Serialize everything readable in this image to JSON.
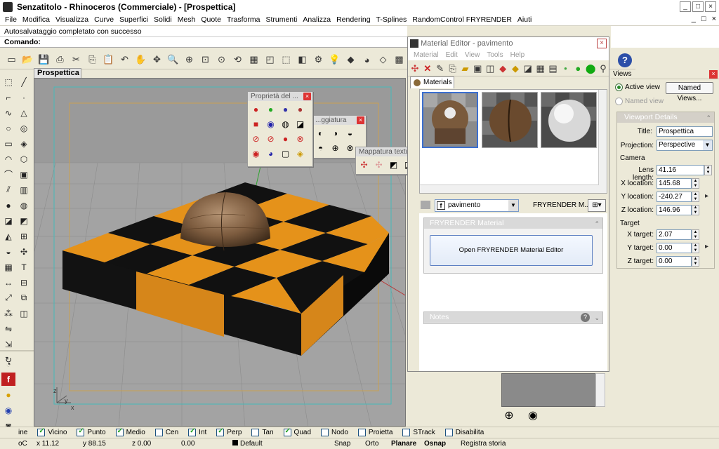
{
  "window": {
    "title": "Senzatitolo - Rhinoceros (Commerciale) - [Prospettica]",
    "min": "_",
    "max": "□",
    "close": "×"
  },
  "menu": [
    "File",
    "Modifica",
    "Visualizza",
    "Curve",
    "Superfici",
    "Solidi",
    "Mesh",
    "Quote",
    "Trasforma",
    "Strumenti",
    "Analizza",
    "Rendering",
    "T-Splines",
    "RandomControl FRYRENDER",
    "Aiuti"
  ],
  "mdi_controls": [
    "_",
    "□",
    "×"
  ],
  "command": {
    "history": "Autosalvataggio completato con successo",
    "prompt": "Comando:"
  },
  "viewport": {
    "tab": "Prospettica",
    "axis_x": "x",
    "axis_y": "y",
    "axis_z": "z"
  },
  "float_windows": {
    "proprieta": "Proprietà del ...",
    "ombreggiatura": "...ggiatura",
    "mappatura": "Mappatura texture",
    "close": "×"
  },
  "material_editor": {
    "title": "Material Editor - pavimento",
    "close": "×",
    "menu": [
      "Material",
      "Edit",
      "View",
      "Tools",
      "Help"
    ],
    "tab": "Materials",
    "selected_material": "pavimento",
    "material_glyph": "f",
    "renderer": "FRYRENDER M...",
    "panel_title": "FRYRENDER Material",
    "open_button": "Open FRYRENDER Material Editor",
    "notes_title": "Notes",
    "help_glyph": "?",
    "collapse_glyph": "⌃",
    "expand_glyph": "⌄"
  },
  "views_panel": {
    "title": "Views",
    "close": "×",
    "active_view": "Active view",
    "named_view": "Named view",
    "named_views_button": "Named Views...",
    "details_title": "Viewport Details",
    "collapse_glyph": "⌃",
    "title_label": "Title:",
    "title_value": "Prospettica",
    "projection_label": "Projection:",
    "projection_value": "Perspective",
    "camera_label": "Camera",
    "lens_label": "Lens length:",
    "lens_value": "41.16",
    "xloc_label": "X location:",
    "xloc_value": "145.68",
    "yloc_label": "Y location:",
    "yloc_value": "-240.27",
    "zloc_label": "Z location:",
    "zloc_value": "146.96",
    "target_label": "Target",
    "xtarget_label": "X target:",
    "xtarget_value": "2.07",
    "ytarget_label": "Y target:",
    "ytarget_value": "0.00",
    "ztarget_label": "Z target:",
    "ztarget_value": "0.00"
  },
  "osnap": [
    {
      "label": "ine",
      "checked": null
    },
    {
      "label": "Vicino",
      "checked": true
    },
    {
      "label": "Punto",
      "checked": true
    },
    {
      "label": "Medio",
      "checked": true
    },
    {
      "label": "Cen",
      "checked": false
    },
    {
      "label": "Int",
      "checked": true
    },
    {
      "label": "Perp",
      "checked": true
    },
    {
      "label": "Tan",
      "checked": false
    },
    {
      "label": "Quad",
      "checked": true
    },
    {
      "label": "Nodo",
      "checked": false
    },
    {
      "label": "Proietta",
      "checked": false
    },
    {
      "label": "STrack",
      "checked": false
    },
    {
      "label": "Disabilita",
      "checked": false
    }
  ],
  "status": {
    "cplane": "oC",
    "x": "x 11.12",
    "y": "y 88.15",
    "z": "z 0.00",
    "dist": "0.00",
    "layer": "Default",
    "snap": "Snap",
    "orto": "Orto",
    "planare": "Planare",
    "osnap": "Osnap",
    "history": "Registra storia"
  },
  "colors": {
    "accent_blue": "#2c4fa8",
    "checker_orange": "#e5921a",
    "checker_black": "#111111",
    "viewport_bg": "#9e9e9e"
  }
}
